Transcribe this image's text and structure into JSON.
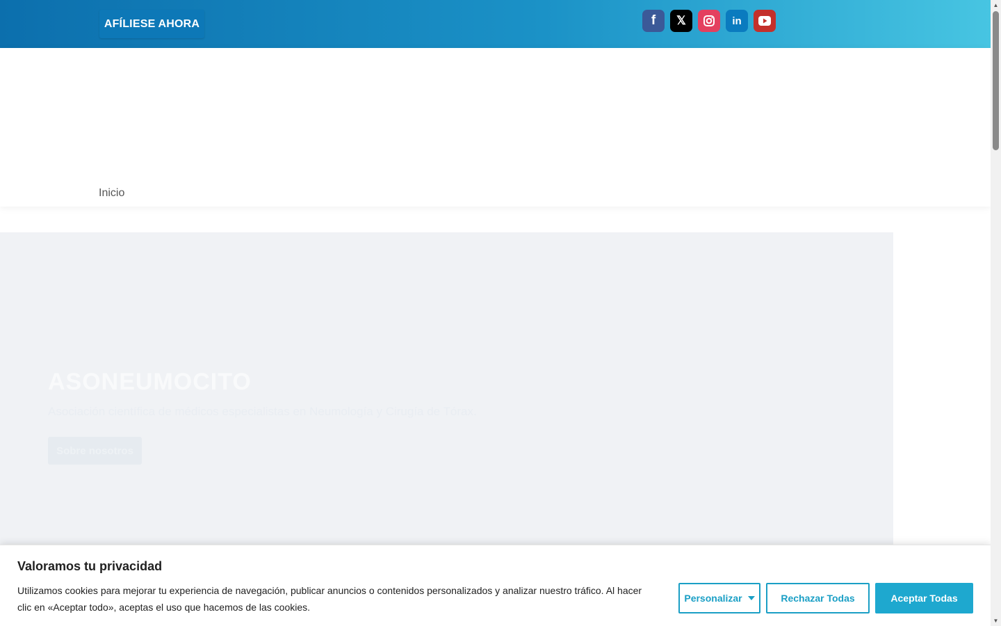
{
  "topbar": {
    "join_button": "AFÍLIESE AHORA",
    "social": [
      {
        "name": "facebook",
        "glyph": "f",
        "color": "#3b5998"
      },
      {
        "name": "x",
        "glyph": "𝕏",
        "color": "#000000"
      },
      {
        "name": "instagram",
        "glyph": "◎",
        "color": "#e4405f"
      },
      {
        "name": "linkedin",
        "glyph": "in",
        "color": "#0a7bbf"
      },
      {
        "name": "youtube",
        "glyph": "▶",
        "color": "#c4302b"
      }
    ]
  },
  "nav": {
    "home": "Inicio"
  },
  "hero": {
    "title": "ASONEUMOCITO",
    "subtitle": "Asociación científica de médicos especialistas en Neumología y Cirugía de Tórax.",
    "button": "Sobre nosotros"
  },
  "cookie": {
    "title": "Valoramos tu privacidad",
    "text": "Utilizamos cookies para mejorar tu experiencia de navegación, publicar anuncios o contenidos personalizados y analizar nuestro tráfico. Al hacer clic en «Aceptar todo», aceptas el uso que hacemos de las cookies.",
    "customize": "Personalizar",
    "reject": "Rechazar Todas",
    "accept": "Aceptar Todas"
  },
  "colors": {
    "accent": "#1ea8cf",
    "topbar_start": "#0c6fad",
    "topbar_end": "#47c5e2"
  }
}
